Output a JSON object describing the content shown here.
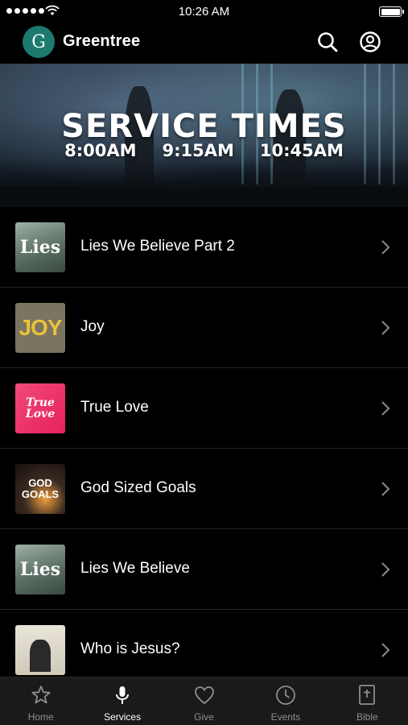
{
  "status_bar": {
    "time": "10:26 AM",
    "signal_dots": 5
  },
  "header": {
    "logo_letter": "G",
    "title": "Greentree"
  },
  "banner": {
    "title": "SERVICE TIMES",
    "times": [
      "8:00AM",
      "9:15AM",
      "10:45AM"
    ]
  },
  "items": [
    {
      "title": "Lies We Believe Part 2",
      "thumb_text": "Lies",
      "thumb_icon": "lies-thumbnail"
    },
    {
      "title": "Joy",
      "thumb_text": "JOY",
      "thumb_icon": "joy-thumbnail"
    },
    {
      "title": "True Love",
      "thumb_text": "True Love",
      "thumb_icon": "true-love-thumbnail"
    },
    {
      "title": "God Sized Goals",
      "thumb_text": "GOD GOALS",
      "thumb_icon": "god-goals-thumbnail"
    },
    {
      "title": "Lies We Believe",
      "thumb_text": "Lies",
      "thumb_icon": "lies-thumbnail"
    },
    {
      "title": "Who is Jesus?",
      "thumb_text": "",
      "thumb_icon": "jesus-thumbnail"
    }
  ],
  "tabs": [
    {
      "label": "Home",
      "icon": "star-icon",
      "active": false
    },
    {
      "label": "Services",
      "icon": "microphone-icon",
      "active": true
    },
    {
      "label": "Give",
      "icon": "heart-icon",
      "active": false
    },
    {
      "label": "Events",
      "icon": "clock-icon",
      "active": false
    },
    {
      "label": "Bible",
      "icon": "bible-icon",
      "active": false
    }
  ],
  "colors": {
    "accent": "#1c7a6e",
    "background": "#000000",
    "tabbar": "#1a1a1a",
    "inactive_tab": "#8e8e8e"
  }
}
